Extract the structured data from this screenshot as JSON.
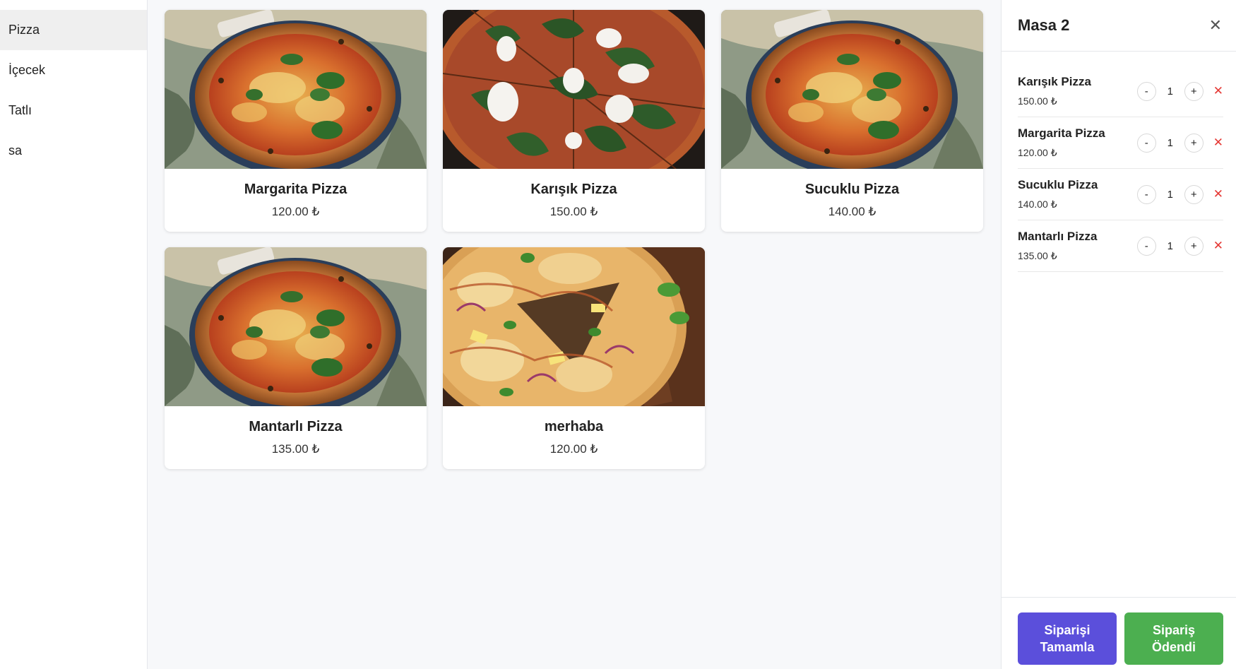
{
  "sidebar": {
    "categories": [
      {
        "label": "Pizza",
        "active": true
      },
      {
        "label": "İçecek"
      },
      {
        "label": "Tatlı"
      },
      {
        "label": "sa"
      }
    ]
  },
  "products": [
    {
      "name": "Margarita Pizza",
      "price": "120.00 ₺",
      "image": "margherita-pizza-photo"
    },
    {
      "name": "Karışık Pizza",
      "price": "150.00 ₺",
      "image": "spinach-mozzarella-pizza-photo"
    },
    {
      "name": "Sucuklu Pizza",
      "price": "140.00 ₺",
      "image": "margherita-pizza-photo"
    },
    {
      "name": "Mantarlı Pizza",
      "price": "135.00 ₺",
      "image": "margherita-pizza-photo"
    },
    {
      "name": "merhaba",
      "price": "120.00 ₺",
      "image": "chicken-pineapple-pizza-photo"
    }
  ],
  "order_panel": {
    "title": "Masa 2",
    "close_icon": "✕",
    "items": [
      {
        "name": "Karışık Pizza",
        "price": "150.00 ₺",
        "qty": "1"
      },
      {
        "name": "Margarita Pizza",
        "price": "120.00 ₺",
        "qty": "1"
      },
      {
        "name": "Sucuklu Pizza",
        "price": "140.00 ₺",
        "qty": "1"
      },
      {
        "name": "Mantarlı Pizza",
        "price": "135.00 ₺",
        "qty": "1"
      }
    ],
    "minus_label": "-",
    "plus_label": "+",
    "remove_icon": "✕",
    "complete_label": "Siparişi Tamamla",
    "paid_label": "Sipariş Ödendi"
  },
  "colors": {
    "complete_button": "#5b4fdb",
    "paid_button": "#4caf50",
    "remove_icon": "#e53935",
    "active_category": "#efefef"
  }
}
